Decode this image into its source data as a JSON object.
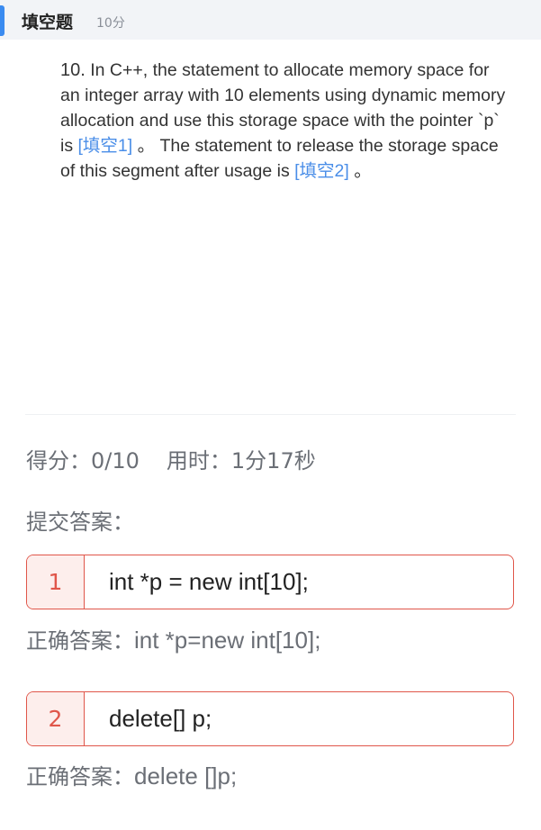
{
  "header": {
    "type_label": "填空题",
    "points_label": "10分"
  },
  "question": {
    "number": "10.",
    "text_part1": "In C++, the statement to allocate memory space for an integer array with 10 elements using dynamic memory allocation and use this storage space with the pointer `p` is ",
    "blank1": "[填空1]",
    "text_part2": " 。 The statement to release the storage space of this segment after usage is ",
    "blank2": "[填空2]",
    "text_part3": " 。"
  },
  "result": {
    "score_label": "得分：",
    "score_value": "0/10",
    "time_label": "用时：",
    "time_value": "1分17秒"
  },
  "submitted": {
    "label": "提交答案："
  },
  "answers": [
    {
      "index": "1",
      "submitted": "int *p = new int[10];",
      "correct_label": "正确答案：",
      "correct": "int *p=new int[10];"
    },
    {
      "index": "2",
      "submitted": "delete[] p;",
      "correct_label": "正确答案：",
      "correct": "delete []p;"
    }
  ],
  "colors": {
    "accent": "#3a8bf0",
    "blank": "#4a8ee8",
    "error": "#e0564a"
  }
}
